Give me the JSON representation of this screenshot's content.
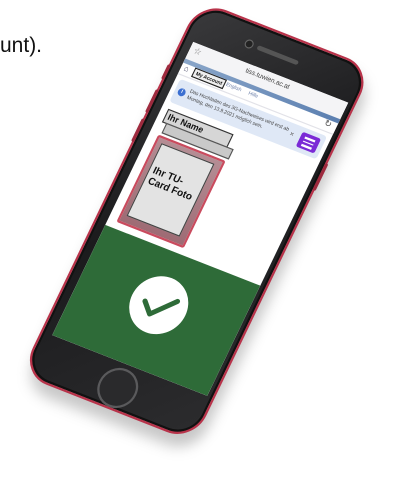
{
  "caption": {
    "text": "unt)."
  },
  "browser": {
    "url": "tiss.tuwien.ac.at"
  },
  "nav": {
    "button_label": "My Account",
    "lang_en": "English",
    "lang_help": "Hilfe"
  },
  "notice": {
    "text": "Das Hochladen des 3G-Nachweises wird erst ab Montag, den 13.9.2021 möglich sein."
  },
  "card": {
    "name_label": "Ihr Name",
    "photo_label": "Ihr TU-Card Foto"
  },
  "status": {
    "state": "valid"
  },
  "colors": {
    "status_green": "#2e6b38",
    "menu_purple": "#7b2bd6",
    "phone_frame_red": "#b8334a",
    "notice_blue": "#dfe8f6"
  },
  "icons": {
    "checkmark": "check-icon",
    "info": "info-icon",
    "refresh": "refresh-icon",
    "menu": "menu-icon",
    "bookmark": "star-icon"
  }
}
